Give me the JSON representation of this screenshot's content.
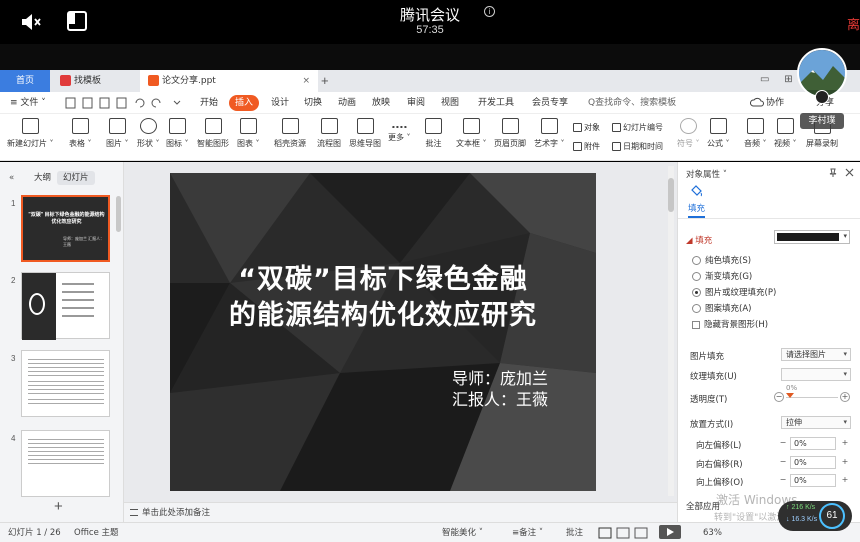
{
  "meeting": {
    "title": "腾讯会议",
    "time": "57:35",
    "info_glyph": "i",
    "leave_label": "离"
  },
  "tabs": {
    "home": "首页",
    "template": "找模板",
    "doc": "论文分享.ppt",
    "close_glyph": "×",
    "new_tab": "+"
  },
  "window_controls": "▭ ⊞ ⊡",
  "menu": {
    "file": "≡ 文件 ˅",
    "items": [
      "开始",
      "插入",
      "设计",
      "切换",
      "动画",
      "放映",
      "审阅",
      "视图",
      "开发工具",
      "会员专享"
    ],
    "active_index": 1,
    "search": "Q查找命令、搜索模板",
    "collab": "协作",
    "share": "分享"
  },
  "ribbon": {
    "large": [
      {
        "label": "新建幻灯片 ˅"
      },
      {
        "label": "表格 ˅"
      },
      {
        "label": "图片 ˅"
      },
      {
        "label": "形状 ˅"
      },
      {
        "label": "图标 ˅"
      },
      {
        "label": "智能图形"
      },
      {
        "label": "图表 ˅"
      },
      {
        "label": "稻壳资源"
      },
      {
        "label": "流程图"
      },
      {
        "label": "思维导图"
      },
      {
        "label": "更多 ˅"
      },
      {
        "label": "批注"
      },
      {
        "label": "文本框 ˅"
      },
      {
        "label": "页眉页脚"
      },
      {
        "label": "艺术字 ˅"
      },
      {
        "label": "符号 ˅"
      },
      {
        "label": "公式 ˅"
      },
      {
        "label": "音频 ˅"
      },
      {
        "label": "视频 ˅"
      },
      {
        "label": "屏幕录制"
      }
    ],
    "small": [
      "对象",
      "幻灯片编号",
      "附件",
      "日期和时间"
    ]
  },
  "left_panel": {
    "tab_outline": "大纲",
    "tab_slides": "幻灯片",
    "collapse": "«",
    "thumb_numbers": [
      "1",
      "2",
      "3",
      "4"
    ],
    "thumb1_title": "\"双碳\" 目标下绿色金融的能源结构优化效应研究",
    "thumb1_sub": "导师：庞加兰 汇报人：王薇",
    "add": "+"
  },
  "slide": {
    "title_line1": "“双碳”目标下绿色金融",
    "title_line2": "的能源结构优化效应研究",
    "advisor": "导师：庞加兰",
    "reporter": "汇报人：王薇",
    "background": "#2b2b2b"
  },
  "notes": {
    "placeholder": "单击此处添加备注"
  },
  "right_panel": {
    "title": "对象属性 ˅",
    "tab_fill": "填充",
    "section_fill": "◢ 填充",
    "fill_options": [
      {
        "label": "纯色填充(S)",
        "checked": false
      },
      {
        "label": "渐变填充(G)",
        "checked": false
      },
      {
        "label": "图片或纹理填充(P)",
        "checked": true
      },
      {
        "label": "图案填充(A)",
        "checked": false
      }
    ],
    "hide_bg": "隐藏背景图形(H)",
    "picture_fill_label": "图片填充",
    "picture_fill_value": "请选择图片",
    "texture_fill_label": "纹理填充(U)",
    "transparency_label": "透明度(T)",
    "transparency_value": "0%",
    "placement_label": "放置方式(I)",
    "placement_value": "拉伸",
    "offsets": [
      {
        "label": "向左偏移(L)",
        "value": "0%"
      },
      {
        "label": "向右偏移(R)",
        "value": "0%"
      },
      {
        "label": "向上偏移(O)",
        "value": "0%"
      }
    ],
    "apply_all": "全部应用",
    "minus": "−",
    "plus": "+"
  },
  "status": {
    "slide_count": "幻灯片 1 / 26",
    "theme": "Office 主题",
    "beautify": "智能美化 ˅",
    "notes": "≡备注 ˅",
    "comments": "批注",
    "zoom": "63%"
  },
  "participant": {
    "name": "李村璞"
  },
  "watermark": {
    "line1": "激活 Windows",
    "line2": "转到\"设置\"以激活 Windows。"
  },
  "net_speed": {
    "up": "↑ 216 K/s",
    "down": "↓ 16.3 K/s",
    "percent": "61"
  },
  "colors": {
    "accent_orange": "#f05a22",
    "tab_blue": "#3b7de0",
    "leave_red": "#e53935"
  }
}
